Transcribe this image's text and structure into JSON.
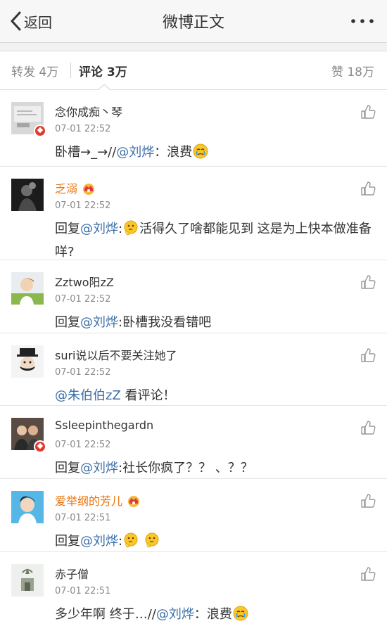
{
  "nav": {
    "back_label": "返回",
    "title": "微博正文",
    "more_icon": "more-dots-icon"
  },
  "tabs": {
    "repost": "转发 4万",
    "comment": "评论 3万",
    "like": "赞 18万"
  },
  "comments": [
    {
      "name": "念你成痴丶琴",
      "time": "07-01 22:52",
      "vip": false,
      "badge": true,
      "text_before": "卧槽→_→//",
      "mention": "@刘烨",
      "text_after": "：浪费",
      "emoji": [
        "cry"
      ]
    },
    {
      "name": "乏溺",
      "time": "07-01 22:52",
      "vip": true,
      "badge": false,
      "text_before": "回复",
      "mention": "@刘烨",
      "text_after": ":",
      "emoji_mid": [
        "think"
      ],
      "text_tail": "活得久了啥都能见到 这是为上快本做准备咩?"
    },
    {
      "name": "Zztwo阳zZ",
      "time": "07-01 22:52",
      "vip": false,
      "badge": false,
      "text_before": "回复",
      "mention": "@刘烨",
      "text_after": ":卧槽我没看错吧"
    },
    {
      "name": "suri说以后不要关注她了",
      "time": "07-01 22:52",
      "vip": false,
      "badge": false,
      "text_before": "",
      "mention": "@朱伯伯zZ",
      "text_after": " 看评论！"
    },
    {
      "name": "Ssleepinthegardn",
      "time": "07-01 22:52",
      "vip": false,
      "badge": true,
      "text_before": "回复",
      "mention": "@刘烨",
      "text_after": ":社长你疯了？？ 、？？"
    },
    {
      "name": "爱举纲的芳儿",
      "time": "07-01 22:51",
      "vip": true,
      "badge": false,
      "text_before": "回复",
      "mention": "@刘烨",
      "text_after": ":",
      "emoji": [
        "think",
        "think"
      ]
    },
    {
      "name": "赤子僧",
      "time": "07-01 22:51",
      "vip": false,
      "badge": false,
      "text_before": "多少年啊 终于…//",
      "mention": "@刘烨",
      "text_after": "：浪费",
      "emoji": [
        "cry"
      ]
    }
  ],
  "colors": {
    "mention": "#3c6fa8",
    "vip_name": "#e8730a",
    "badge": "#e03a2f"
  }
}
